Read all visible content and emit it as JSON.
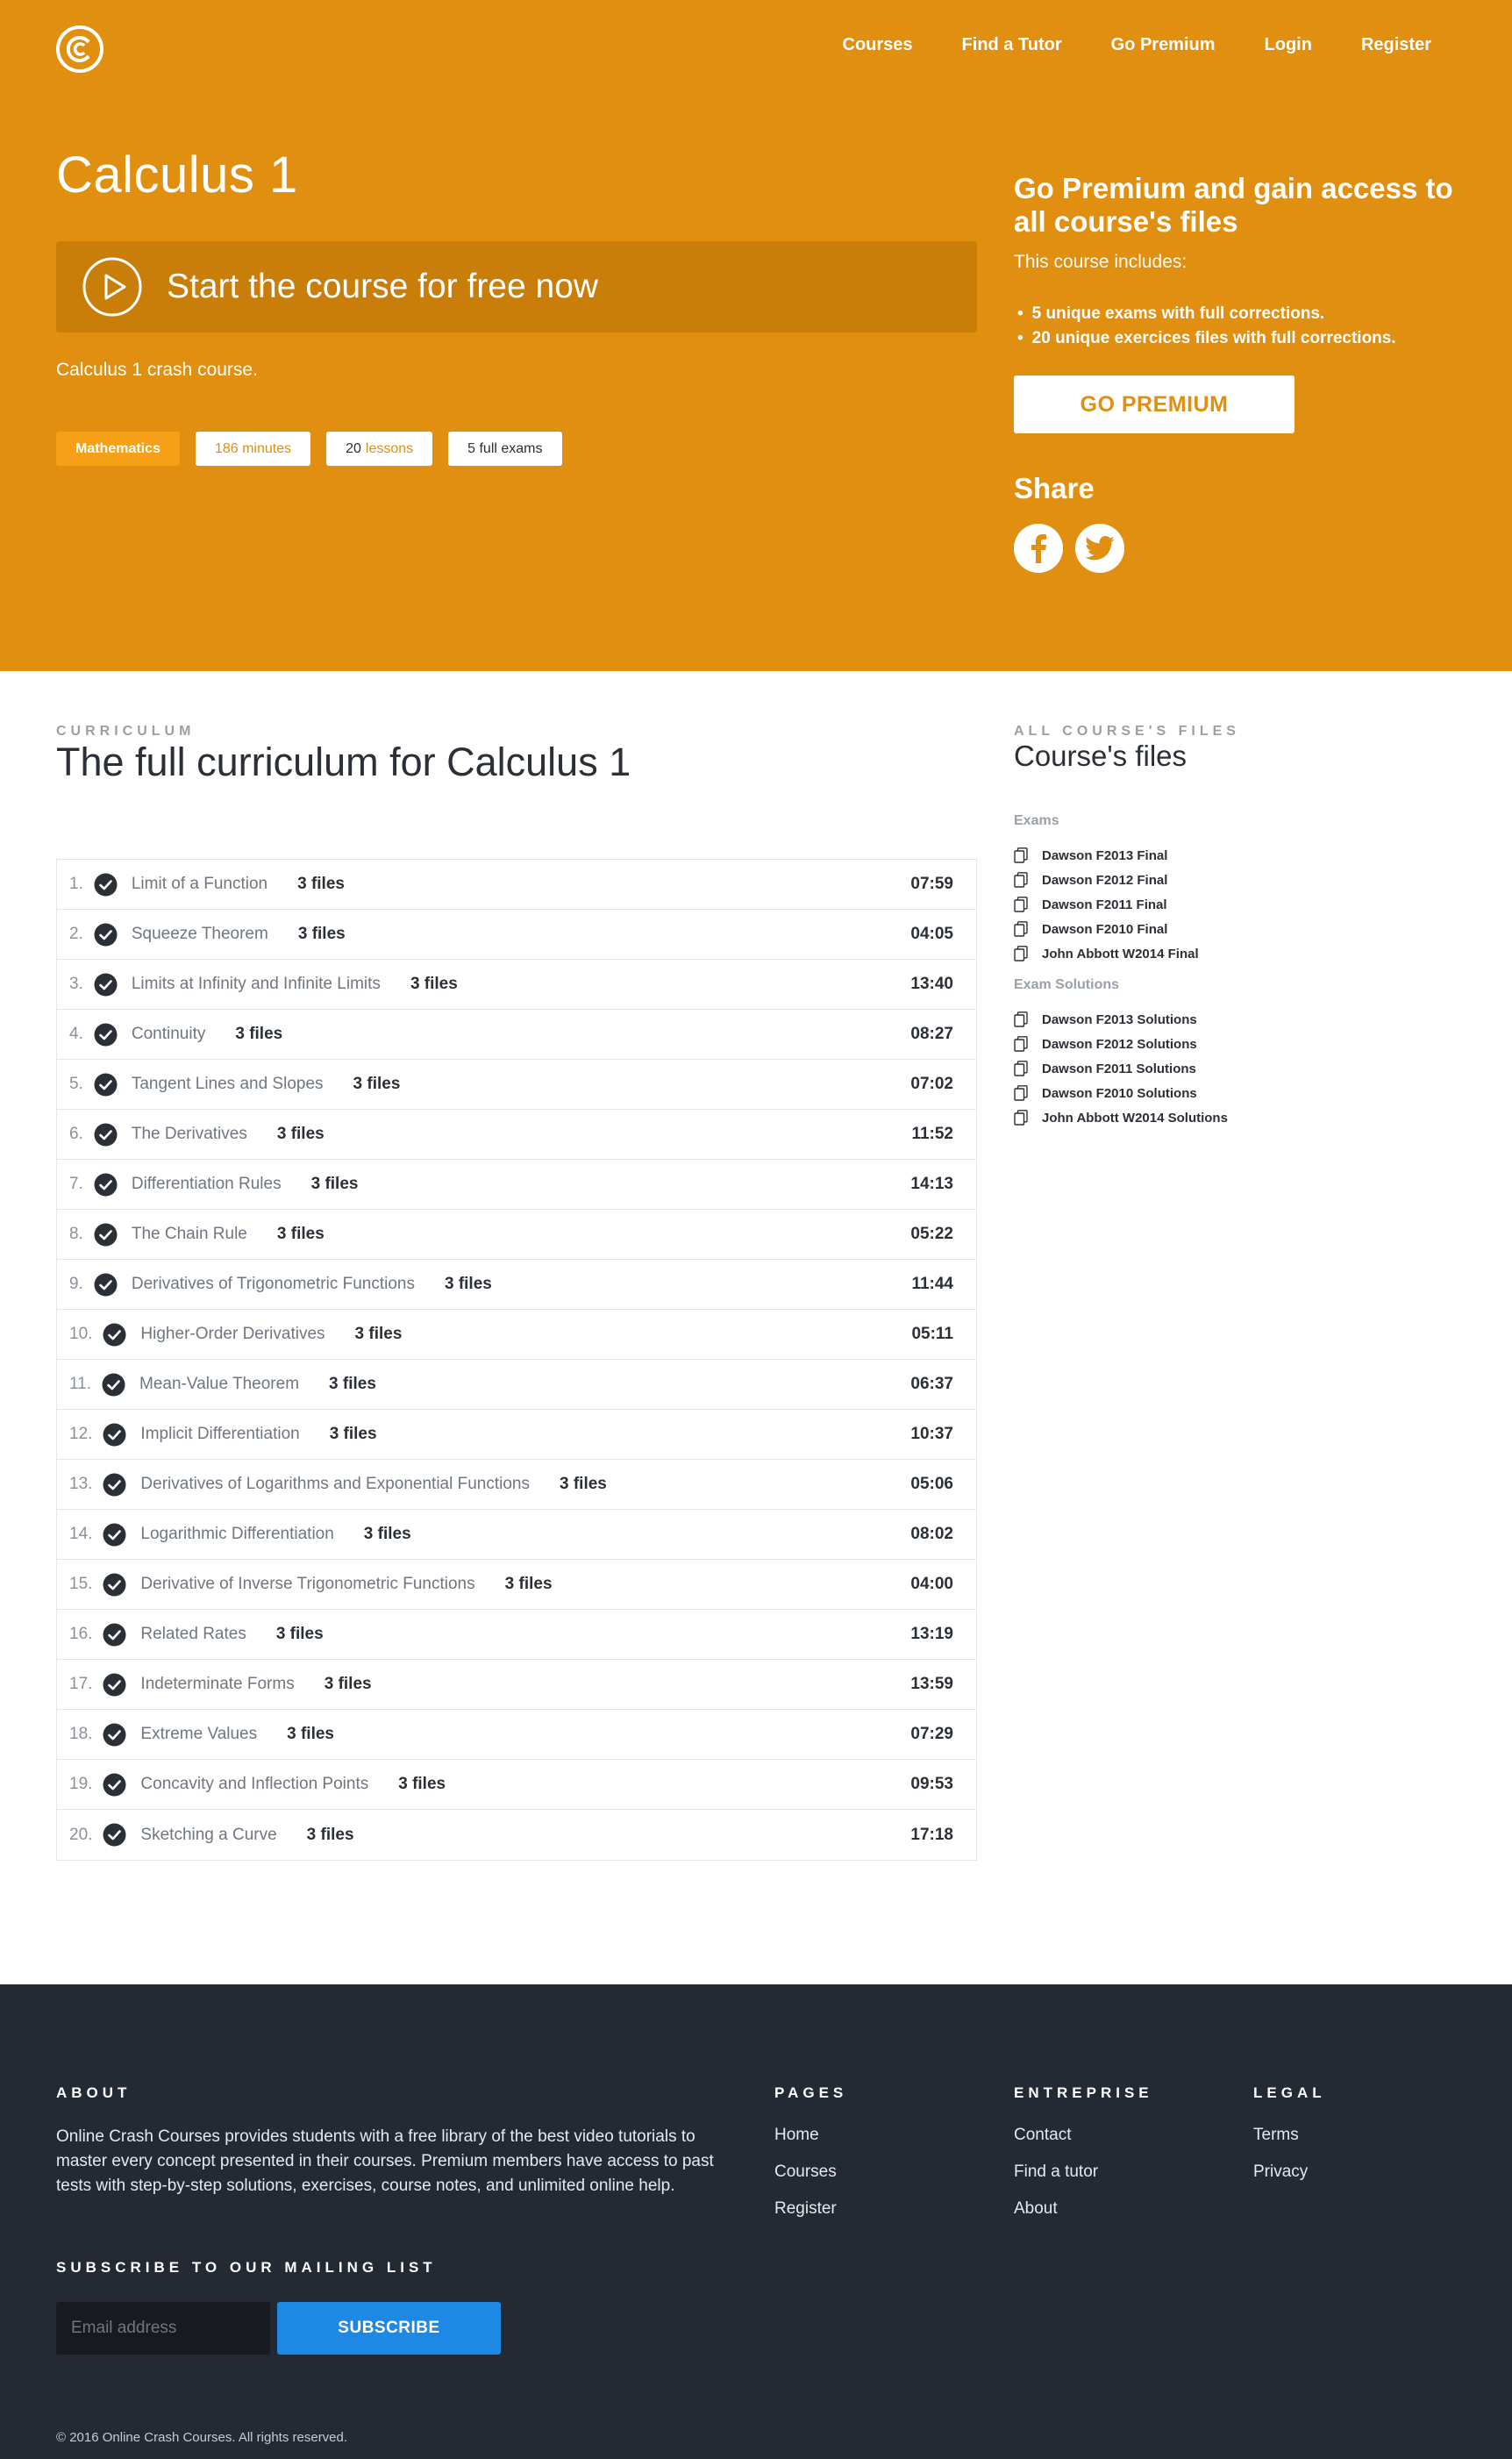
{
  "header": {
    "logo_icon": "course-logo-icon",
    "nav": [
      "Courses",
      "Find a Tutor",
      "Go Premium",
      "Login",
      "Register"
    ]
  },
  "hero": {
    "title": "Calculus 1",
    "start_label": "Start the course for free now",
    "description": "Calculus 1 crash course.",
    "tags": {
      "subject": "Mathematics",
      "minutes": "186 minutes",
      "lessons_count": "20",
      "lessons_word": "lessons",
      "exams": "5 full exams"
    }
  },
  "premium": {
    "title": "Go Premium and gain access to all course's files",
    "subtitle": "This course includes:",
    "includes": [
      "5 unique exams with full corrections.",
      "20 unique exercices files with full corrections."
    ],
    "button": "GO PREMIUM",
    "share_title": "Share",
    "share_icons": [
      "facebook-icon",
      "twitter-icon"
    ]
  },
  "curriculum": {
    "eyebrow": "CURRICULUM",
    "title": "The full curriculum for Calculus 1",
    "lessons": [
      {
        "num": "1.",
        "name": "Limit of a Function",
        "files": "3 files",
        "duration": "07:59"
      },
      {
        "num": "2.",
        "name": "Squeeze Theorem",
        "files": "3 files",
        "duration": "04:05"
      },
      {
        "num": "3.",
        "name": "Limits at Infinity and Infinite Limits",
        "files": "3 files",
        "duration": "13:40"
      },
      {
        "num": "4.",
        "name": "Continuity",
        "files": "3 files",
        "duration": "08:27"
      },
      {
        "num": "5.",
        "name": "Tangent Lines and Slopes",
        "files": "3 files",
        "duration": "07:02"
      },
      {
        "num": "6.",
        "name": "The Derivatives",
        "files": "3 files",
        "duration": "11:52"
      },
      {
        "num": "7.",
        "name": "Differentiation Rules",
        "files": "3 files",
        "duration": "14:13"
      },
      {
        "num": "8.",
        "name": "The Chain Rule",
        "files": "3 files",
        "duration": "05:22"
      },
      {
        "num": "9.",
        "name": "Derivatives of Trigonometric Functions",
        "files": "3 files",
        "duration": "11:44"
      },
      {
        "num": "10.",
        "name": "Higher-Order Derivatives",
        "files": "3 files",
        "duration": "05:11"
      },
      {
        "num": "11.",
        "name": "Mean-Value Theorem",
        "files": "3 files",
        "duration": "06:37"
      },
      {
        "num": "12.",
        "name": "Implicit Differentiation",
        "files": "3 files",
        "duration": "10:37"
      },
      {
        "num": "13.",
        "name": "Derivatives of Logarithms and Exponential Functions",
        "files": "3 files",
        "duration": "05:06"
      },
      {
        "num": "14.",
        "name": "Logarithmic Differentiation",
        "files": "3 files",
        "duration": "08:02"
      },
      {
        "num": "15.",
        "name": "Derivative of Inverse Trigonometric Functions",
        "files": "3 files",
        "duration": "04:00"
      },
      {
        "num": "16.",
        "name": "Related Rates",
        "files": "3 files",
        "duration": "13:19"
      },
      {
        "num": "17.",
        "name": "Indeterminate Forms",
        "files": "3 files",
        "duration": "13:59"
      },
      {
        "num": "18.",
        "name": "Extreme Values",
        "files": "3 files",
        "duration": "07:29"
      },
      {
        "num": "19.",
        "name": "Concavity and Inflection Points",
        "files": "3 files",
        "duration": "09:53"
      },
      {
        "num": "20.",
        "name": "Sketching a Curve",
        "files": "3 files",
        "duration": "17:18"
      }
    ]
  },
  "course_files": {
    "eyebrow": "ALL COURSE'S FILES",
    "title": "Course's files",
    "exams_title": "Exams",
    "exams": [
      "Dawson F2013 Final",
      "Dawson F2012 Final",
      "Dawson F2011 Final",
      "Dawson F2010 Final",
      "John Abbott W2014 Final"
    ],
    "solutions_title": "Exam Solutions",
    "solutions": [
      "Dawson F2013 Solutions",
      "Dawson F2012 Solutions",
      "Dawson F2011 Solutions",
      "Dawson F2010 Solutions",
      "John Abbott W2014 Solutions"
    ]
  },
  "footer": {
    "about_title": "ABOUT",
    "about_text": "Online Crash Courses provides students with a free library of the best video tutorials to master every concept presented in their courses. Premium members have access to past tests with step-by-step solutions, exercises, course notes, and unlimited online help.",
    "pages_title": "PAGES",
    "pages": [
      "Home",
      "Courses",
      "Register"
    ],
    "entreprise_title": "ENTREPRISE",
    "entreprise": [
      "Contact",
      "Find a tutor",
      "About"
    ],
    "legal_title": "LEGAL",
    "legal": [
      "Terms",
      "Privacy"
    ],
    "subscribe_title": "SUBSCRIBE TO OUR MAILING LIST",
    "email_placeholder": "Email address",
    "subscribe_button": "SUBSCRIBE",
    "copyright": "© 2016 Online Crash Courses. All rights reserved."
  },
  "colors": {
    "brand_orange": "#e08f10",
    "footer_bg": "#242a33",
    "subscribe_blue": "#1e88e5"
  }
}
